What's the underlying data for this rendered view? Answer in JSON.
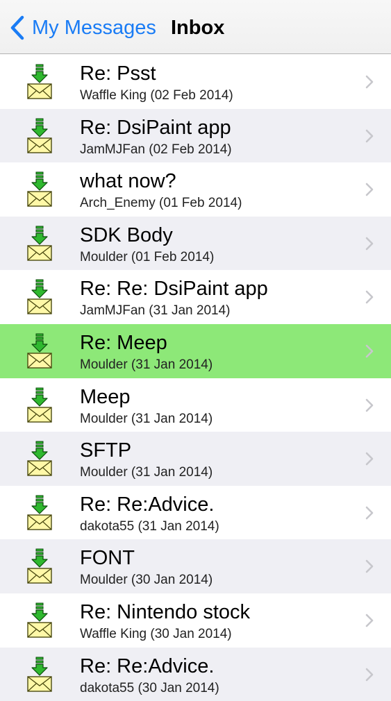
{
  "navbar": {
    "back_label": "My Messages",
    "title": "Inbox"
  },
  "colors": {
    "accent": "#1a7cf5",
    "selected_row": "#8de878",
    "alt_row": "#efeff4",
    "icon_arrow": "#2fb82f",
    "icon_envelope": "#fff8a8"
  },
  "messages": [
    {
      "subject": "Re: Psst",
      "meta": "Waffle King (02 Feb 2014)",
      "icon": "download-envelope-icon",
      "selected": false
    },
    {
      "subject": "Re: DsiPaint app",
      "meta": "JamMJFan (02 Feb 2014)",
      "icon": "download-envelope-icon",
      "selected": false
    },
    {
      "subject": "what now?",
      "meta": "Arch_Enemy (01 Feb 2014)",
      "icon": "download-envelope-icon",
      "selected": false
    },
    {
      "subject": "SDK Body",
      "meta": "Moulder (01 Feb 2014)",
      "icon": "download-envelope-icon",
      "selected": false
    },
    {
      "subject": "Re: Re: DsiPaint app",
      "meta": "JamMJFan (31 Jan 2014)",
      "icon": "download-envelope-icon",
      "selected": false
    },
    {
      "subject": "Re: Meep",
      "meta": "Moulder (31 Jan 2014)",
      "icon": "download-envelope-icon",
      "selected": true
    },
    {
      "subject": "Meep",
      "meta": "Moulder (31 Jan 2014)",
      "icon": "download-envelope-icon",
      "selected": false
    },
    {
      "subject": "SFTP",
      "meta": "Moulder (31 Jan 2014)",
      "icon": "download-envelope-icon",
      "selected": false
    },
    {
      "subject": "Re: Re:Advice.",
      "meta": "dakota55 (31 Jan 2014)",
      "icon": "download-envelope-icon",
      "selected": false
    },
    {
      "subject": "FONT",
      "meta": "Moulder (30 Jan 2014)",
      "icon": "download-envelope-icon",
      "selected": false
    },
    {
      "subject": "Re: Nintendo stock",
      "meta": "Waffle King (30 Jan 2014)",
      "icon": "download-envelope-icon",
      "selected": false
    },
    {
      "subject": "Re: Re:Advice.",
      "meta": "dakota55 (30 Jan 2014)",
      "icon": "download-envelope-icon",
      "selected": false
    }
  ]
}
